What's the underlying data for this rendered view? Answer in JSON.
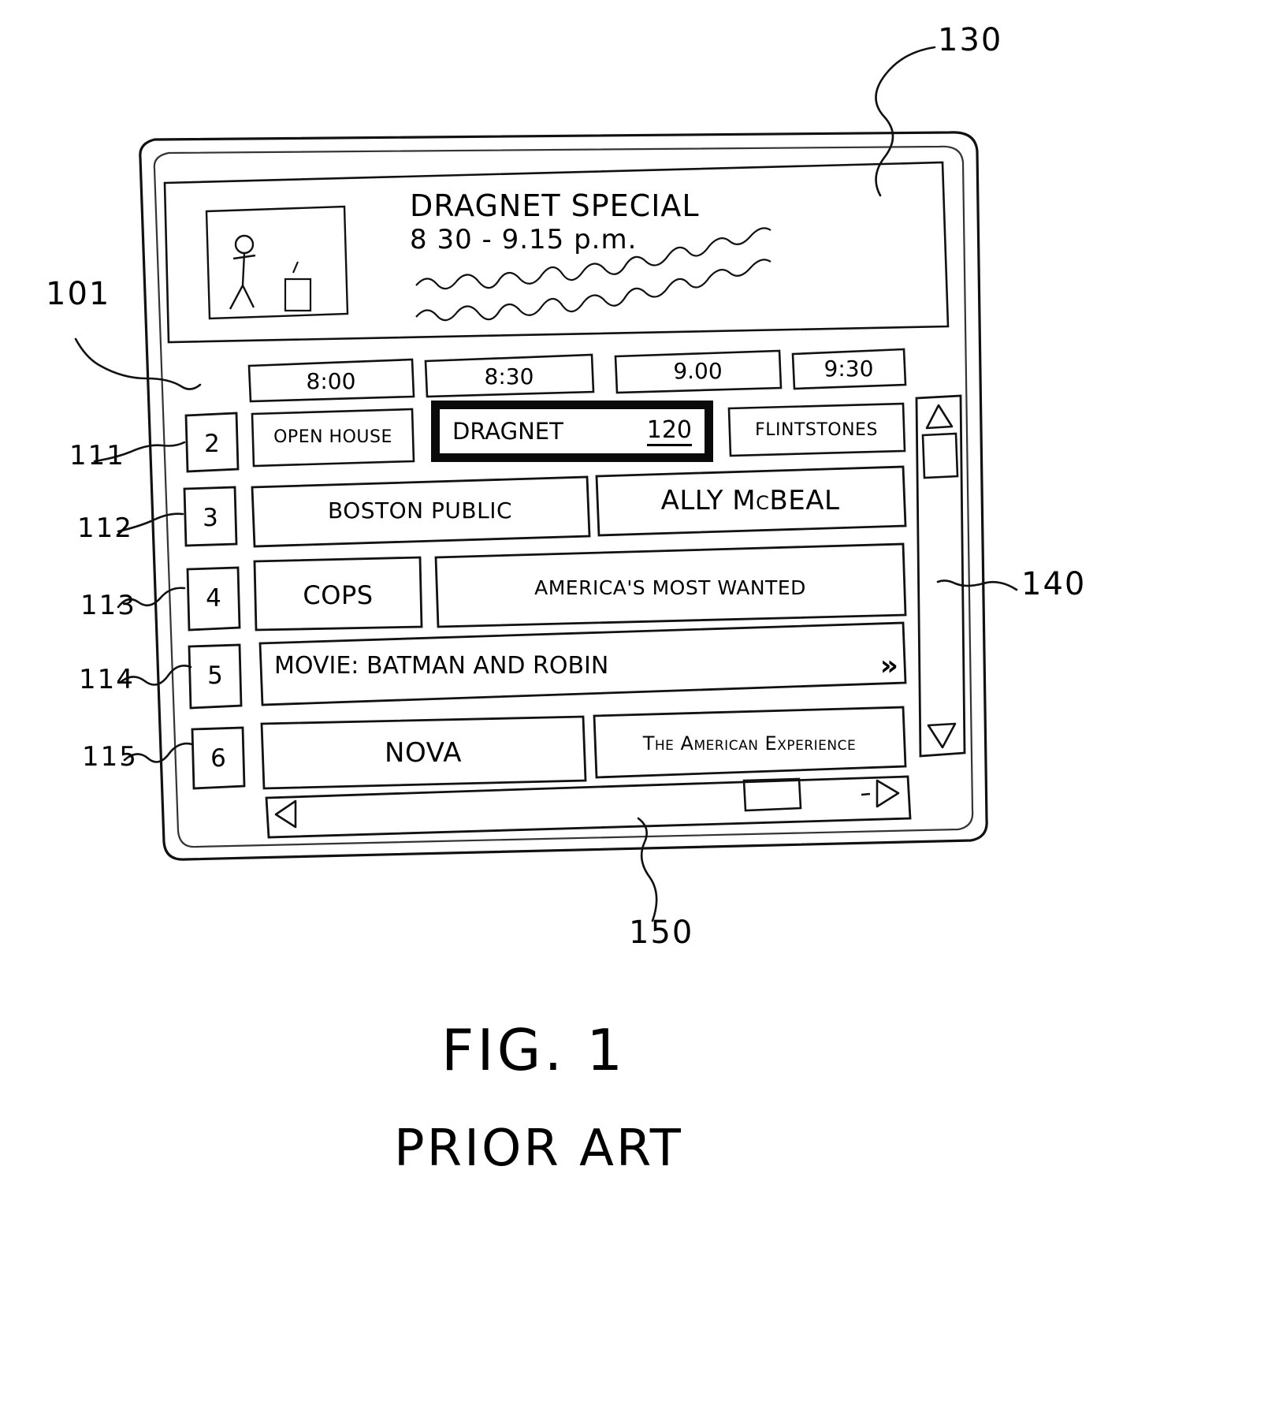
{
  "figure": {
    "caption": "FIG. 1",
    "subcaption": "PRIOR ART"
  },
  "reference_numerals": {
    "device": "101",
    "banner": "130",
    "row1": "111",
    "row2": "112",
    "row3": "113",
    "row4": "114",
    "row5": "115",
    "vertical_scrollbar": "140",
    "horizontal_scrollbar": "150"
  },
  "banner": {
    "title_line1": "DRAGNET SPECIAL",
    "title_line2": "8 30 - 9.15 p.m.",
    "thumbnail_alt": "video-thumbnail"
  },
  "time_header": {
    "slots": [
      "8:00",
      "8:30",
      "9.00",
      "9:30"
    ]
  },
  "grid": {
    "rows": [
      {
        "channel": "2",
        "programs": [
          {
            "title": "OPEN HOUSE",
            "selected": false,
            "badge": ""
          },
          {
            "title": "DRAGNET",
            "selected": true,
            "badge": "120"
          },
          {
            "title": "FLINTSTONES",
            "selected": false,
            "badge": ""
          }
        ]
      },
      {
        "channel": "3",
        "programs": [
          {
            "title": "BOSTON PUBLIC",
            "selected": false,
            "badge": ""
          },
          {
            "title": "ALLY McBEAL",
            "selected": false,
            "badge": ""
          }
        ]
      },
      {
        "channel": "4",
        "programs": [
          {
            "title": "COPS",
            "selected": false,
            "badge": ""
          },
          {
            "title": "AMERICA'S MOST WANTED",
            "selected": false,
            "badge": ""
          }
        ]
      },
      {
        "channel": "5",
        "programs": [
          {
            "title": "MOVIE:  BATMAN AND ROBIN",
            "selected": false,
            "badge": "",
            "continues": true
          }
        ]
      },
      {
        "channel": "6",
        "programs": [
          {
            "title": "NOVA",
            "selected": false,
            "badge": ""
          },
          {
            "title": "The American Experience",
            "selected": false,
            "badge": ""
          }
        ]
      }
    ]
  },
  "scrollbars": {
    "vertical": {
      "up_icon": "triangle-up-icon",
      "down_icon": "triangle-down-icon",
      "thumb": "scroll-thumb"
    },
    "horizontal": {
      "left_icon": "triangle-left-icon",
      "right_icon": "triangle-right-icon",
      "thumb": "scroll-thumb"
    }
  },
  "icons": {
    "continue_arrows": "»"
  },
  "colors": {
    "ink": "#111111",
    "paper": "#ffffff",
    "highlight": "#0a0a0a"
  }
}
